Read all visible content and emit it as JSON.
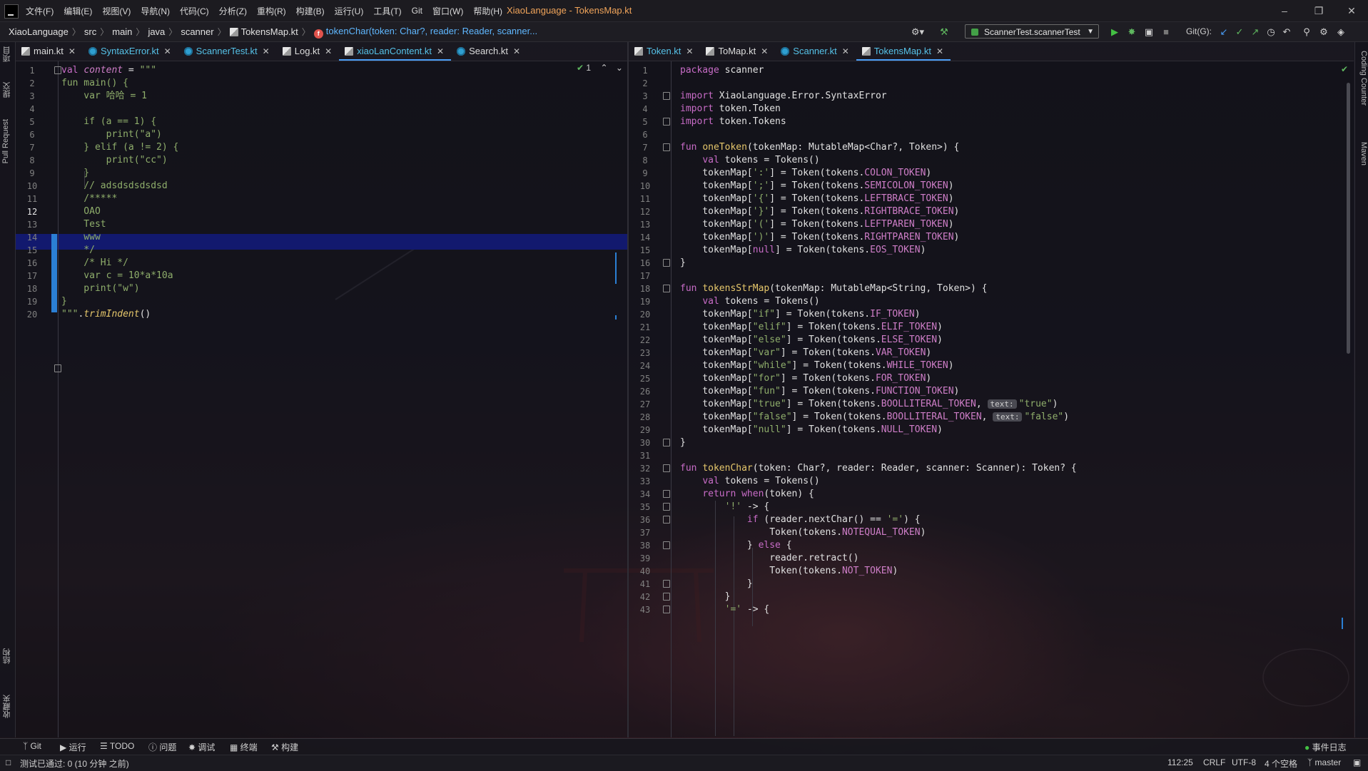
{
  "window": {
    "menus": [
      "文件(F)",
      "编辑(E)",
      "视图(V)",
      "导航(N)",
      "代码(C)",
      "分析(Z)",
      "重构(R)",
      "构建(B)",
      "运行(U)",
      "工具(T)",
      "Git",
      "窗口(W)",
      "帮助(H)"
    ],
    "title": "XiaoLanguage - TokensMap.kt"
  },
  "breadcrumb": {
    "items": [
      "XiaoLanguage",
      "src",
      "main",
      "java",
      "scanner",
      "TokensMap.kt"
    ],
    "function": "tokenChar(token: Char?, reader: Reader, scanner..."
  },
  "toolbar": {
    "run_config": "ScannerTest.scannerTest",
    "git_label": "Git(G):"
  },
  "left_stripe": {
    "labels": [
      "项目",
      "提交",
      "Pull Request",
      "结构",
      "收藏夹"
    ]
  },
  "right_stripe": {
    "labels": [
      "Coding Counter",
      "Maven"
    ]
  },
  "tabs_left": [
    {
      "label": "main.kt",
      "icon": "kotlin-file-icon",
      "active": false,
      "cyan": false
    },
    {
      "label": "SyntaxError.kt",
      "icon": "class-icon",
      "active": false,
      "cyan": true
    },
    {
      "label": "ScannerTest.kt",
      "icon": "class-icon",
      "active": false,
      "cyan": true
    },
    {
      "label": "Log.kt",
      "icon": "kotlin-file-icon",
      "active": false,
      "cyan": false
    },
    {
      "label": "xiaoLanContent.kt",
      "icon": "kotlin-file-icon",
      "active": true,
      "cyan": true
    },
    {
      "label": "Search.kt",
      "icon": "class-icon",
      "active": false,
      "cyan": false
    }
  ],
  "tabs_right": [
    {
      "label": "Token.kt",
      "icon": "kotlin-file-icon",
      "active": false,
      "cyan": true
    },
    {
      "label": "ToMap.kt",
      "icon": "kotlin-file-icon",
      "active": false,
      "cyan": false
    },
    {
      "label": "Scanner.kt",
      "icon": "class-icon",
      "active": false,
      "cyan": true
    },
    {
      "label": "TokensMap.kt",
      "icon": "kotlin-file-icon",
      "active": true,
      "cyan": true
    }
  ],
  "left_editor": {
    "inspection_count": "1",
    "current_line": 12,
    "lines": [
      "<span class=\"kw\">val</span> <span class=\"prop ital\">content</span> = <span class=\"str\">\"\"\"</span>",
      "<span class=\"str\">fun main() {</span>",
      "<span class=\"str\">    var 哈哈 = 1</span>",
      "",
      "<span class=\"str\">    if (a == 1) {</span>",
      "<span class=\"str\">        print(\"a\")</span>",
      "<span class=\"str\">    } elif (a != 2) {</span>",
      "<span class=\"str\">        print(\"cc\")</span>",
      "<span class=\"str\">    }</span>",
      "<span class=\"str\">    // adsdsdsdsdsd</span>",
      "<span class=\"str\">    /*****</span>",
      "<span class=\"str\">    OAO</span>",
      "<span class=\"str\">    Test</span>",
      "<span class=\"str\">    www</span>",
      "<span class=\"str\">    */</span>",
      "<span class=\"str\">    /* Hi */</span>",
      "<span class=\"str\">    var c = 10*a*10a</span>",
      "<span class=\"str\">    print(\"w\")</span>",
      "<span class=\"str\">}</span>",
      "<span class=\"str\">\"\"\"</span>.<span class=\"fnc ital\">trimIndent</span>()"
    ]
  },
  "right_editor": {
    "first_line": 1,
    "lines": [
      "<span class=\"kw\">package</span> scanner",
      "",
      "<span class=\"kw\">import</span> XiaoLanguage.Error.SyntaxError",
      "<span class=\"kw\">import</span> token.Token",
      "<span class=\"kw\">import</span> token.Tokens",
      "",
      "<span class=\"kw\">fun</span> <span class=\"fnc\">oneToken</span>(tokenMap: MutableMap&lt;Char?, Token&gt;) {",
      "    <span class=\"kw\">val</span> tokens = Tokens()",
      "    tokenMap[<span class=\"str\">':'</span>] = Token(tokens.<span class=\"prop\">COLON_TOKEN</span>)",
      "    tokenMap[<span class=\"str\">';'</span>] = Token(tokens.<span class=\"prop\">SEMICOLON_TOKEN</span>)",
      "    tokenMap[<span class=\"str\">'{'</span>] = Token(tokens.<span class=\"prop\">LEFTBRACE_TOKEN</span>)",
      "    tokenMap[<span class=\"str\">'}'</span>] = Token(tokens.<span class=\"prop\">RIGHTBRACE_TOKEN</span>)",
      "    tokenMap[<span class=\"str\">'('</span>] = Token(tokens.<span class=\"prop\">LEFTPAREN_TOKEN</span>)",
      "    tokenMap[<span class=\"str\">')'</span>] = Token(tokens.<span class=\"prop\">RIGHTPAREN_TOKEN</span>)",
      "    tokenMap[<span class=\"kw\">null</span>] = Token(tokens.<span class=\"prop\">EOS_TOKEN</span>)",
      "}",
      "",
      "<span class=\"kw\">fun</span> <span class=\"fnc\">tokensStrMap</span>(tokenMap: MutableMap&lt;String, Token&gt;) {",
      "    <span class=\"kw\">val</span> tokens = Tokens()",
      "    tokenMap[<span class=\"str\">\"if\"</span>] = Token(tokens.<span class=\"prop\">IF_TOKEN</span>)",
      "    tokenMap[<span class=\"str\">\"elif\"</span>] = Token(tokens.<span class=\"prop\">ELIF_TOKEN</span>)",
      "    tokenMap[<span class=\"str\">\"else\"</span>] = Token(tokens.<span class=\"prop\">ELSE_TOKEN</span>)",
      "    tokenMap[<span class=\"str\">\"var\"</span>] = Token(tokens.<span class=\"prop\">VAR_TOKEN</span>)",
      "    tokenMap[<span class=\"str\">\"while\"</span>] = Token(tokens.<span class=\"prop\">WHILE_TOKEN</span>)",
      "    tokenMap[<span class=\"str\">\"for\"</span>] = Token(tokens.<span class=\"prop\">FOR_TOKEN</span>)",
      "    tokenMap[<span class=\"str\">\"fun\"</span>] = Token(tokens.<span class=\"prop\">FUNCTION_TOKEN</span>)",
      "    tokenMap[<span class=\"str\">\"true\"</span>] = Token(tokens.<span class=\"prop\">BOOLLITERAL_TOKEN</span>, <span class=\"hint\">text:</span><span class=\"str\">\"true\"</span>)",
      "    tokenMap[<span class=\"str\">\"false\"</span>] = Token(tokens.<span class=\"prop\">BOOLLITERAL_TOKEN</span>, <span class=\"hint\">text:</span><span class=\"str\">\"false\"</span>)",
      "    tokenMap[<span class=\"str\">\"null\"</span>] = Token(tokens.<span class=\"prop\">NULL_TOKEN</span>)",
      "}",
      "",
      "<span class=\"kw\">fun</span> <span class=\"fnc\">tokenChar</span>(token: Char?, reader: Reader, scanner: Scanner): Token? {",
      "    <span class=\"kw\">val</span> tokens = Tokens()",
      "    <span class=\"kw\">return</span> <span class=\"kw\">when</span>(token) {",
      "        <span class=\"str\">'!'</span> -&gt; {",
      "            <span class=\"kw\">if</span> (reader.nextChar() == <span class=\"str\">'='</span>) {",
      "                Token(tokens.<span class=\"prop\">NOTEQUAL_TOKEN</span>)",
      "            } <span class=\"kw\">else</span> {",
      "                reader.retract()",
      "                Token(tokens.<span class=\"prop\">NOT_TOKEN</span>)",
      "            }",
      "        }",
      "        <span class=\"str\">'='</span> -&gt; {"
    ]
  },
  "bottom_tools": [
    "Git",
    "运行",
    "TODO",
    "问题",
    "调试",
    "终端",
    "构建"
  ],
  "event_log": "事件日志",
  "status": {
    "message": "测试已通过: 0 (10 分钟 之前)",
    "position": "112:25",
    "line_ending": "CRLF",
    "encoding": "UTF-8",
    "indent": "4 个空格",
    "branch": "master"
  }
}
